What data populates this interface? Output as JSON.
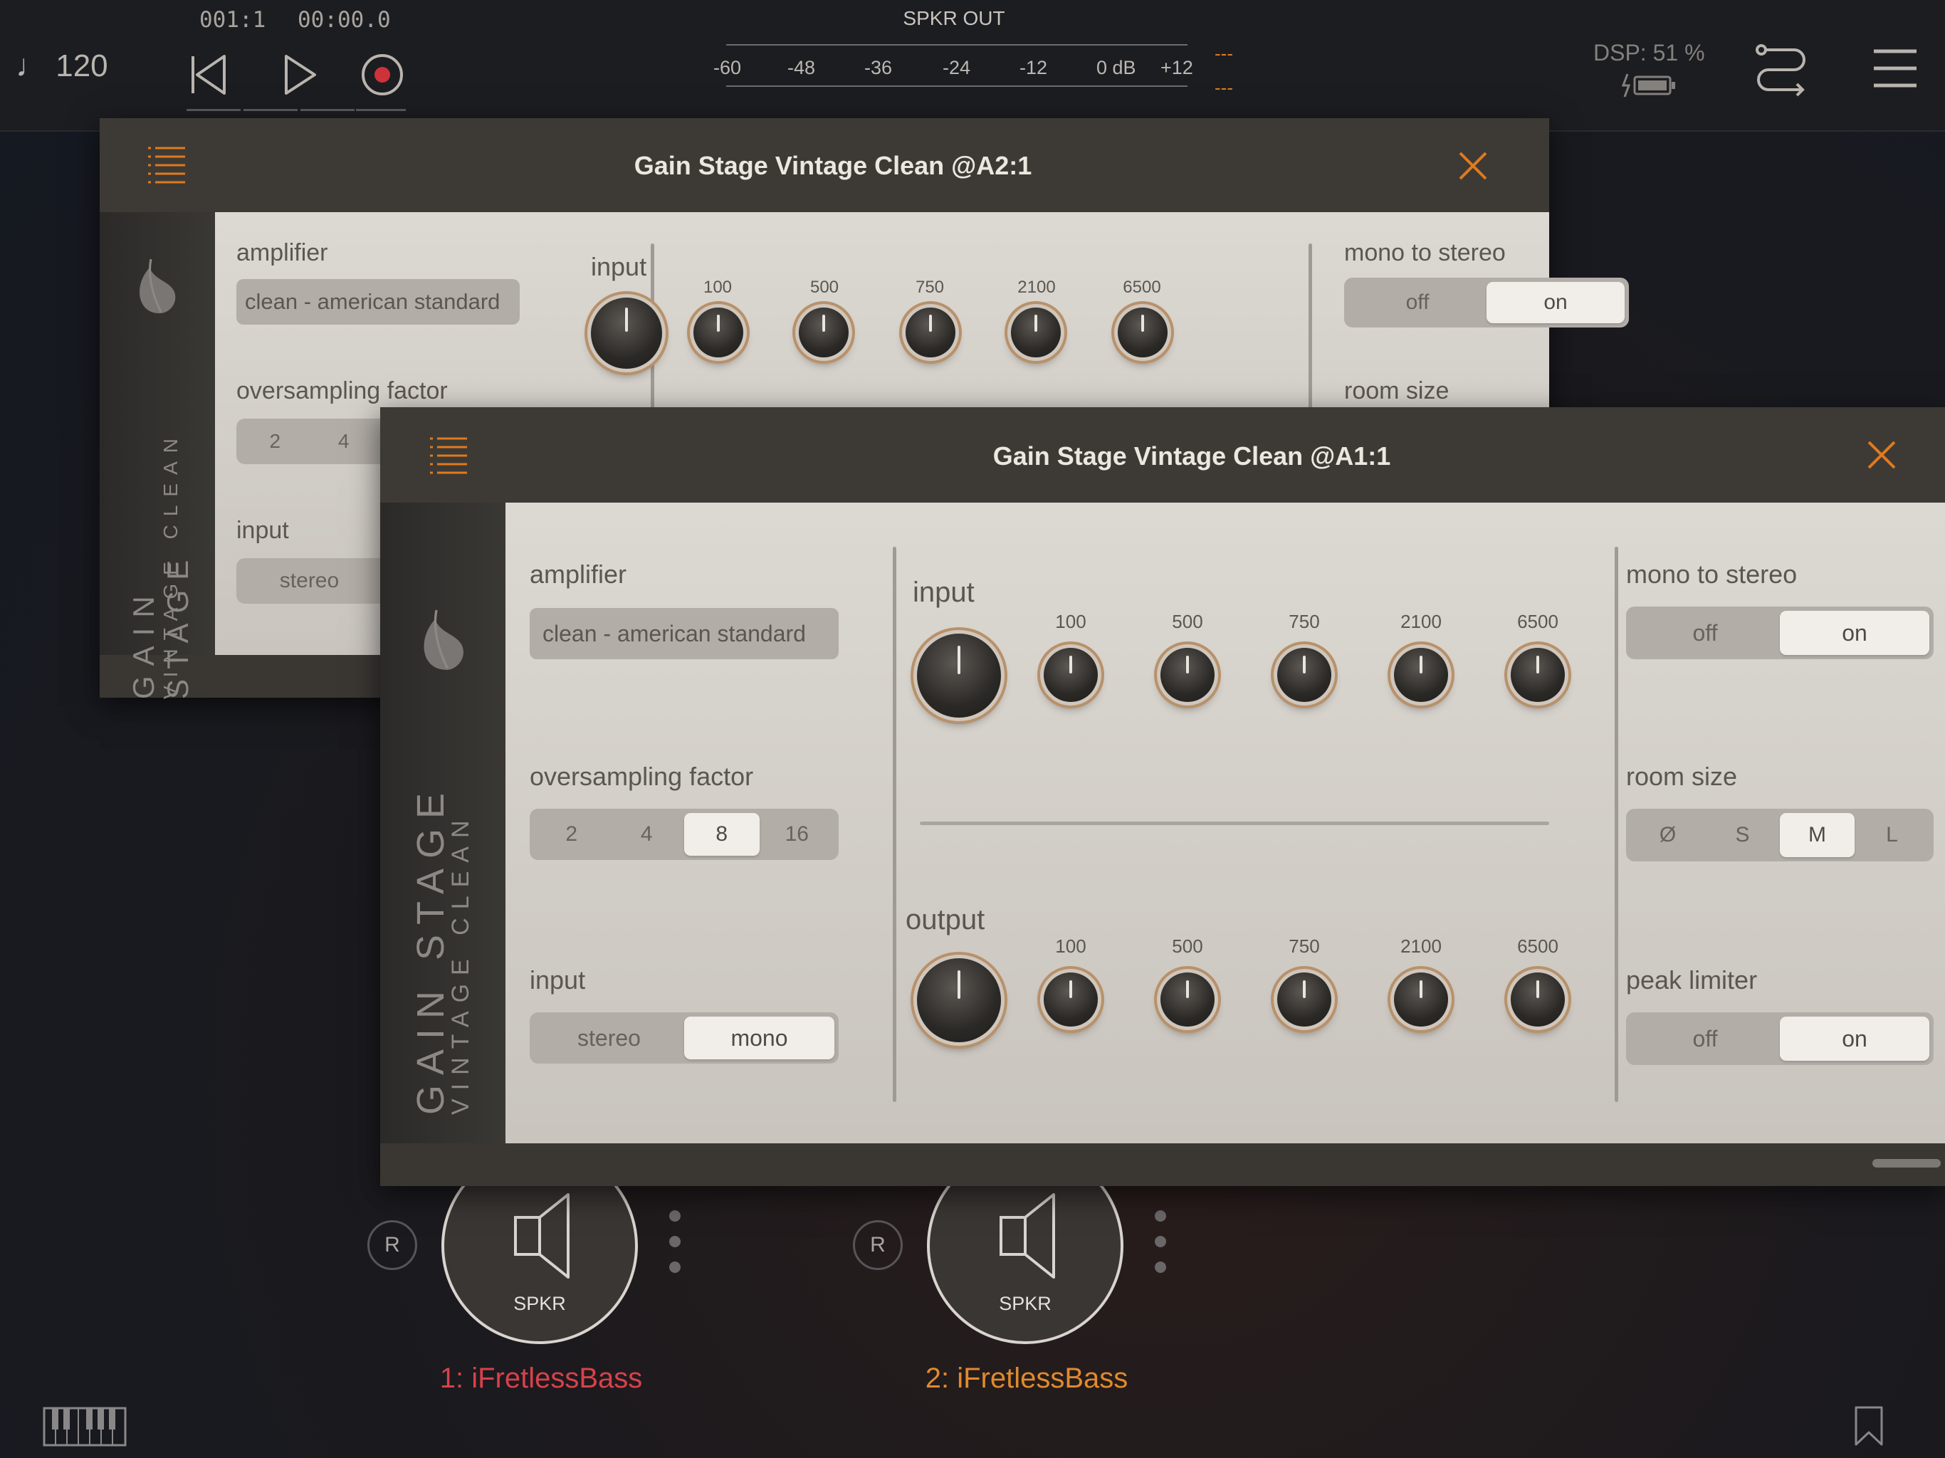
{
  "topbar": {
    "tempo": "♩ 120",
    "bar_position": "001:1",
    "time_position": "00:00.0",
    "meter_title": "SPKR OUT",
    "meter_ticks": [
      "-60",
      "-48",
      "-36",
      "-24",
      "-12",
      "0 dB",
      "+12"
    ],
    "peak_l": "---",
    "peak_r": "---",
    "dsp": "DSP: 51 %"
  },
  "back_window": {
    "title": "Gain Stage Vintage Clean @A2:1",
    "brand_main": "GAIN STAGE",
    "brand_sub": "VINTAGE CLEAN",
    "amplifier_label": "amplifier",
    "amplifier_value": "clean - american standard",
    "oversampling_label": "oversampling factor",
    "oversampling_options": [
      "2",
      "4"
    ],
    "input_label": "input",
    "input_options": [
      "stereo"
    ],
    "eq_input_label": "input",
    "freqs": [
      "100",
      "500",
      "750",
      "2100",
      "6500"
    ],
    "mono_label": "mono to stereo",
    "mono_options": [
      "off",
      "on"
    ],
    "room_label": "room size"
  },
  "front_window": {
    "title": "Gain Stage Vintage Clean @A1:1",
    "brand_main": "GAIN STAGE",
    "brand_sub": "VINTAGE CLEAN",
    "amplifier_label": "amplifier",
    "amplifier_value": "clean - american standard",
    "oversampling_label": "oversampling factor",
    "oversampling_options": [
      "2",
      "4",
      "8",
      "16"
    ],
    "oversampling_selected": "8",
    "input_label": "input",
    "input_options": [
      "stereo",
      "mono"
    ],
    "input_selected": "mono",
    "eq_input_label": "input",
    "eq_output_label": "output",
    "freqs": [
      "100",
      "500",
      "750",
      "2100",
      "6500"
    ],
    "mono_label": "mono to stereo",
    "mono_options": [
      "off",
      "on"
    ],
    "mono_selected": "on",
    "room_label": "room size",
    "room_options": [
      "Ø",
      "S",
      "M",
      "L"
    ],
    "room_selected": "M",
    "peak_label": "peak limiter",
    "peak_options": [
      "off",
      "on"
    ],
    "peak_selected": "on"
  },
  "tracks": [
    {
      "r": "R",
      "node": "SPKR",
      "name": "1: iFretlessBass",
      "color": "#d8414b"
    },
    {
      "r": "R",
      "node": "SPKR",
      "name": "2: iFretlessBass",
      "color": "#e08a2e"
    }
  ],
  "colors": {
    "accent": "#e07a1f"
  },
  "icons": [
    "note-icon",
    "rewind-icon",
    "play-icon",
    "record-icon",
    "routing-icon",
    "menu-icon",
    "list-icon",
    "close-icon",
    "leaf-icon",
    "speaker-icon",
    "keyboard-icon",
    "bookmark-icon",
    "battery-icon"
  ]
}
